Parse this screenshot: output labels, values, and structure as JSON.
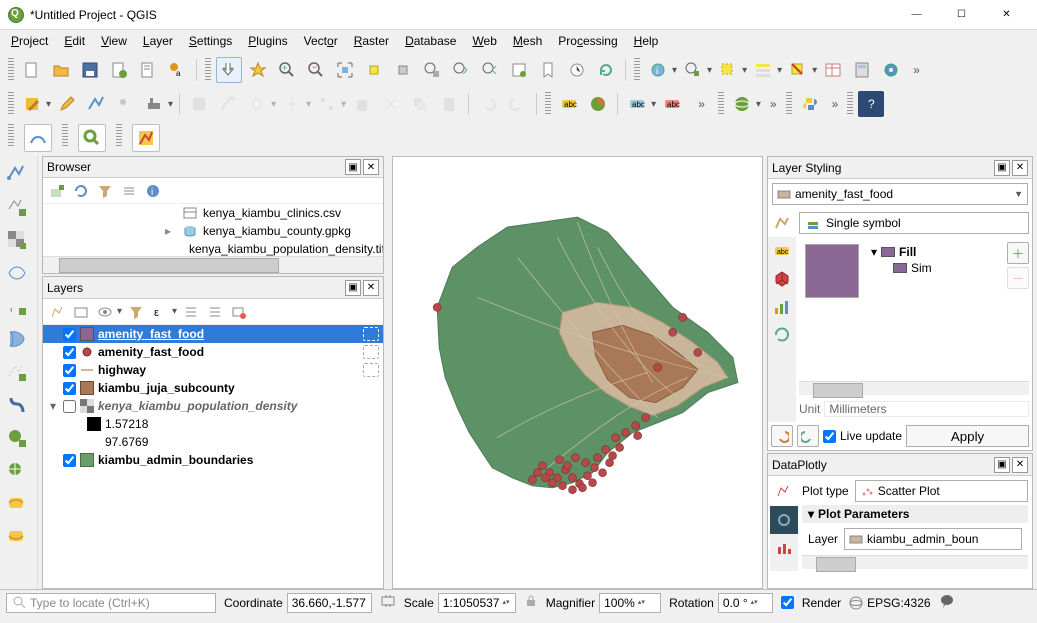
{
  "window": {
    "title": "*Untitled Project - QGIS"
  },
  "menu": [
    "Project",
    "Edit",
    "View",
    "Layer",
    "Settings",
    "Plugins",
    "Vector",
    "Raster",
    "Database",
    "Web",
    "Mesh",
    "Processing",
    "Help"
  ],
  "browser": {
    "title": "Browser",
    "items": [
      {
        "icon": "csv",
        "name": "kenya_kiambu_clinics.csv"
      },
      {
        "icon": "gpkg",
        "name": "kenya_kiambu_county.gpkg",
        "expandable": true
      },
      {
        "icon": "raster",
        "name": "kenya_kiambu_population_density.tif"
      }
    ]
  },
  "layers": {
    "title": "Layers",
    "items": [
      {
        "checked": true,
        "sym": "poly-purple",
        "name": "amenity_fast_food",
        "selected": true,
        "underline": true
      },
      {
        "checked": true,
        "sym": "point-red",
        "name": "amenity_fast_food",
        "bold": true
      },
      {
        "checked": true,
        "sym": "line-tan",
        "name": "highway",
        "bold": true
      },
      {
        "checked": true,
        "sym": "poly-brown",
        "name": "kiambu_juja_subcounty",
        "bold": true
      },
      {
        "checked": false,
        "sym": "raster",
        "name": "kenya_kiambu_population_density",
        "italic": true,
        "bold": true,
        "expander": "down",
        "children": [
          {
            "sym": "sw-black",
            "name": "1.57218"
          },
          {
            "sym": "none",
            "name": "97.6769"
          }
        ]
      },
      {
        "checked": true,
        "sym": "poly-green",
        "name": "kiambu_admin_boundaries",
        "bold": true
      }
    ]
  },
  "styling": {
    "title": "Layer Styling",
    "layer": "amenity_fast_food",
    "renderer": "Single symbol",
    "tree": {
      "fill": "Fill",
      "simple": "Sim"
    },
    "unit_label": "Unit",
    "unit_value": "Millimeters",
    "live_label": "Live update",
    "apply_label": "Apply"
  },
  "dataplotly": {
    "title": "DataPlotly",
    "plot_type_label": "Plot type",
    "plot_type": "Scatter Plot",
    "params_label": "Plot Parameters",
    "layer_label": "Layer",
    "layer_value": "kiambu_admin_boun"
  },
  "status": {
    "locator_placeholder": "Type to locate (Ctrl+K)",
    "coord_label": "Coordinate",
    "coord_value": "36.660,-1.577",
    "scale_label": "Scale",
    "scale_value": "1:1050537",
    "magnifier_label": "Magnifier",
    "magnifier_value": "100%",
    "rotation_label": "Rotation",
    "rotation_value": "0.0 °",
    "render_label": "Render",
    "crs": "EPSG:4326"
  },
  "chart_data": null
}
